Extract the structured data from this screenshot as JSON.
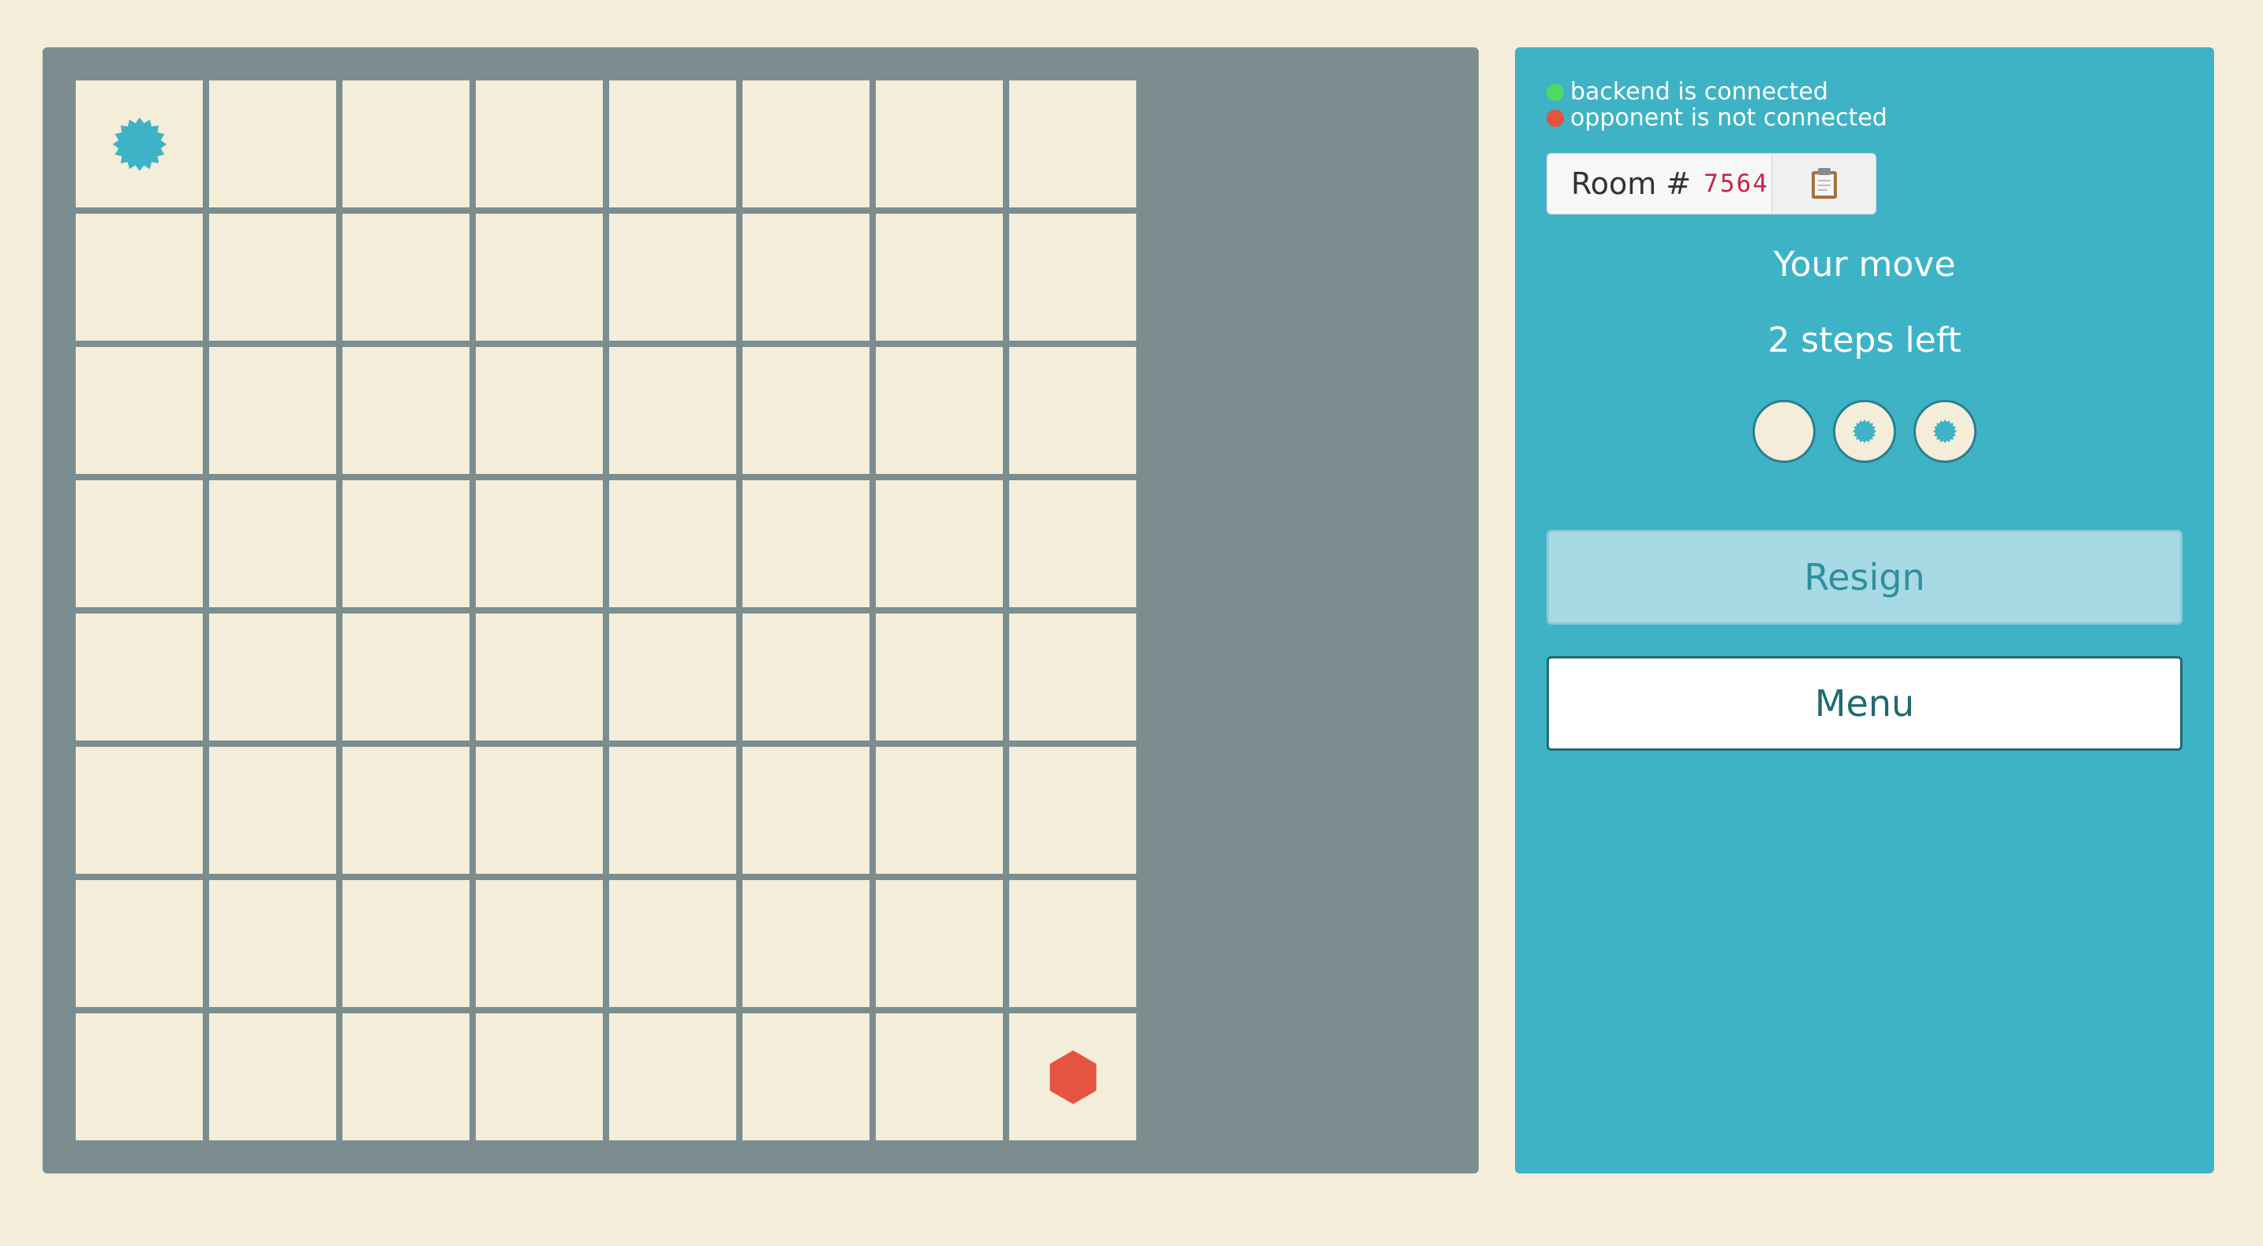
{
  "board": {
    "rows": 8,
    "cols": 8,
    "pieces": [
      {
        "row": 0,
        "col": 0,
        "type": "sun",
        "color": "#3eb3c6"
      },
      {
        "row": 7,
        "col": 7,
        "type": "hexagon",
        "color": "#e45440"
      }
    ]
  },
  "status": {
    "backend_text": "backend is connected",
    "backend_color": "#4cd964",
    "opponent_text": "opponent is not connected",
    "opponent_color": "#e45440"
  },
  "room": {
    "label": "Room #",
    "code": "7564",
    "copy_icon": "clipboard-icon"
  },
  "turn": {
    "title": "Your move",
    "steps_text": "2 steps left"
  },
  "steps": [
    {
      "filled": false
    },
    {
      "filled": true
    },
    {
      "filled": true
    }
  ],
  "buttons": {
    "resign": "Resign",
    "menu": "Menu"
  },
  "colors": {
    "background": "#f3edda",
    "board_frame": "#7c8d90",
    "panel": "#3eb3c6",
    "player_piece": "#3eb3c6",
    "opponent_piece": "#e45440"
  }
}
